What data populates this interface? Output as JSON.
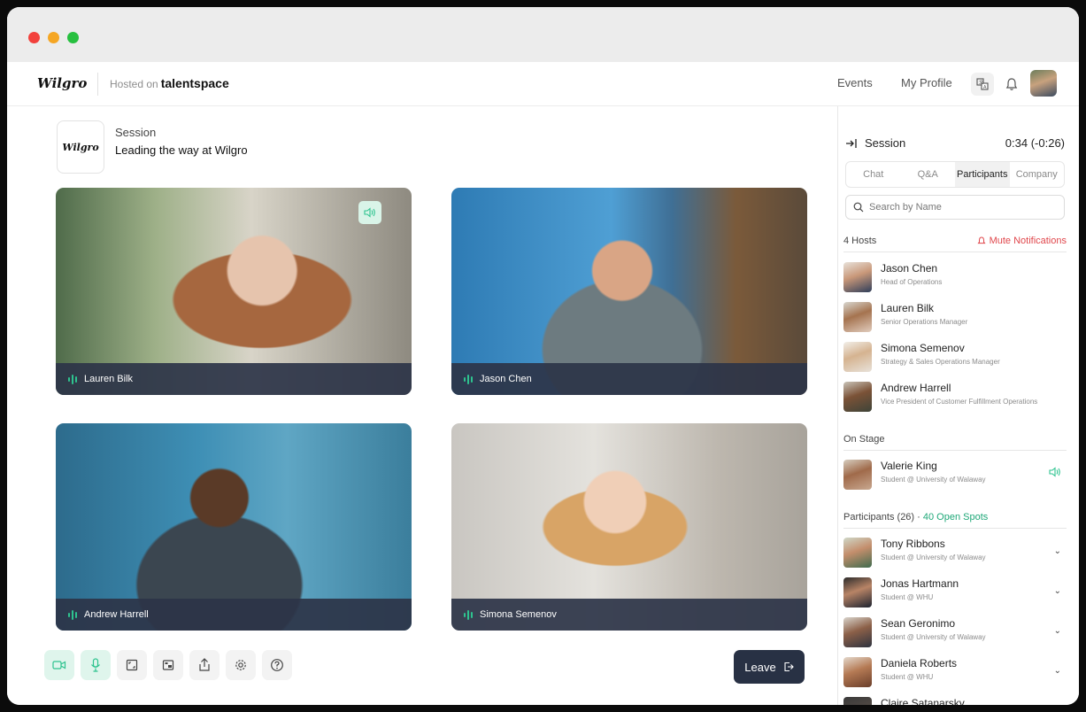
{
  "app": {
    "logo": "Wilgro",
    "hosted_prefix": "Hosted on",
    "host_brand": "talentspace"
  },
  "nav": {
    "events": "Events",
    "profile": "My Profile",
    "translate_icon": "translate-icon",
    "bell_icon": "bell-icon"
  },
  "session": {
    "logo": "Wilgro",
    "label": "Session",
    "title": "Leading the way at Wilgro"
  },
  "videos": [
    {
      "name": "Lauren Bilk",
      "speaking": true
    },
    {
      "name": "Jason Chen",
      "speaking": false
    },
    {
      "name": "Andrew Harrell",
      "speaking": false
    },
    {
      "name": "Simona Semenov",
      "speaking": false
    }
  ],
  "toolbar": {
    "leave_label": "Leave",
    "icons": [
      "video-icon",
      "microphone-icon",
      "fullscreen-icon",
      "picture-in-picture-icon",
      "share-icon",
      "settings-icon",
      "help-icon"
    ]
  },
  "sidebar": {
    "title": "Session",
    "timer": "0:34 (-0:26)",
    "tabs": [
      "Chat",
      "Q&A",
      "Participants",
      "Company"
    ],
    "active_tab": "Participants",
    "search_placeholder": "Search by Name",
    "hosts_label": "4 Hosts",
    "mute_label": "Mute Notifications",
    "hosts": [
      {
        "name": "Jason Chen",
        "role": "Head of Operations"
      },
      {
        "name": "Lauren Bilk",
        "role": "Senior Operations Manager"
      },
      {
        "name": "Simona Semenov",
        "role": "Strategy & Sales Operations Manager"
      },
      {
        "name": "Andrew Harrell",
        "role": "Vice President of Customer Fulfillment Operations"
      }
    ],
    "on_stage_label": "On Stage",
    "on_stage": [
      {
        "name": "Valerie King",
        "role": "Student @ University of Walaway"
      }
    ],
    "participants_label": "Participants (26)",
    "participants_sep": " · ",
    "open_spots": "40 Open Spots",
    "participants": [
      {
        "name": "Tony Ribbons",
        "role": "Student @ University of Walaway"
      },
      {
        "name": "Jonas Hartmann",
        "role": "Student @ WHU"
      },
      {
        "name": "Sean Geronimo",
        "role": "Student @ University of Walaway"
      },
      {
        "name": "Daniela Roberts",
        "role": "Student @ WHU"
      },
      {
        "name": "Claire Satanarsky",
        "role": ""
      }
    ]
  },
  "colors": {
    "accent_green": "#2ec38f",
    "mute_red": "#e0464b",
    "leave_bg": "#283144"
  }
}
